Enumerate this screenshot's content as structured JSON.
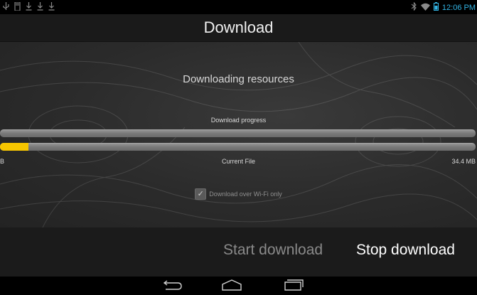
{
  "status_bar": {
    "left_icons": [
      "usb-icon",
      "sd-card-icon",
      "download-icon",
      "download-icon",
      "download-icon"
    ],
    "time": "12:06 PM"
  },
  "header": {
    "title": "Download"
  },
  "main": {
    "heading": "Downloading resources",
    "progress_label": "Download progress",
    "overall_progress": 0,
    "file_progress": 0.06,
    "file_left_label": "B",
    "file_center_label": "Current File",
    "file_right_label": "34.4 MB",
    "wifi_checkbox": {
      "label": "Download over Wi-Fi only",
      "checked": true
    }
  },
  "actions": {
    "start_label": "Start download",
    "stop_label": "Stop download"
  },
  "colors": {
    "progress_fill": "#f7c600",
    "time_text": "#33b5e5"
  }
}
